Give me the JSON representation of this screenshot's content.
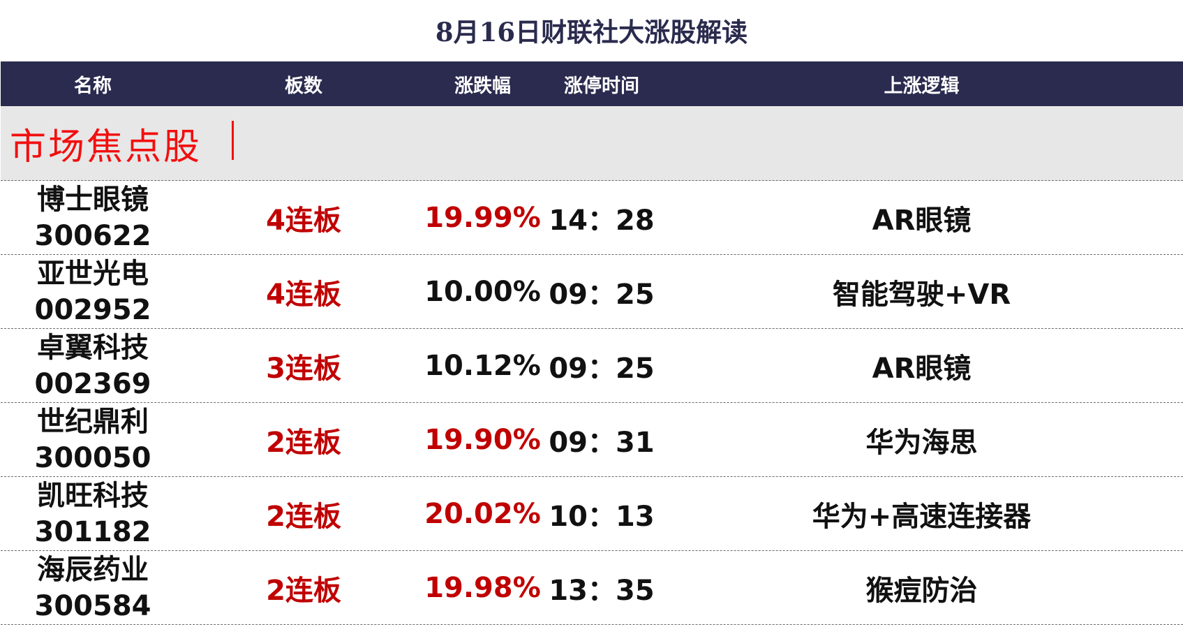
{
  "title": "8月16日财联社大涨股解读",
  "colors": {
    "header_bg": "#2a2b4f",
    "section_bg": "#e7e7e7",
    "accent_red": "#c00000",
    "section_red": "#f20f0f"
  },
  "table": {
    "headers": {
      "name": "名称",
      "board": "板数",
      "change": "涨跌幅",
      "time": "涨停时间",
      "logic": "上涨逻辑"
    },
    "section_label": "市场焦点股",
    "rows": [
      {
        "name": "博士眼镜",
        "code": "300622",
        "board": "4连板",
        "change": "19.99%",
        "change_color": "#c00000",
        "time": "14：28",
        "logic": "AR眼镜"
      },
      {
        "name": "亚世光电",
        "code": "002952",
        "board": "4连板",
        "change": "10.00%",
        "change_color": "#111111",
        "time": "09：25",
        "logic": "智能驾驶+VR"
      },
      {
        "name": "卓翼科技",
        "code": "002369",
        "board": "3连板",
        "change": "10.12%",
        "change_color": "#111111",
        "time": "09：25",
        "logic": "AR眼镜"
      },
      {
        "name": "世纪鼎利",
        "code": "300050",
        "board": "2连板",
        "change": "19.90%",
        "change_color": "#c00000",
        "time": "09：31",
        "logic": "华为海思"
      },
      {
        "name": "凯旺科技",
        "code": "301182",
        "board": "2连板",
        "change": "20.02%",
        "change_color": "#c00000",
        "time": "10：13",
        "logic": "华为+高速连接器"
      },
      {
        "name": "海辰药业",
        "code": "300584",
        "board": "2连板",
        "change": "19.98%",
        "change_color": "#c00000",
        "time": "13：35",
        "logic": "猴痘防治"
      }
    ]
  }
}
